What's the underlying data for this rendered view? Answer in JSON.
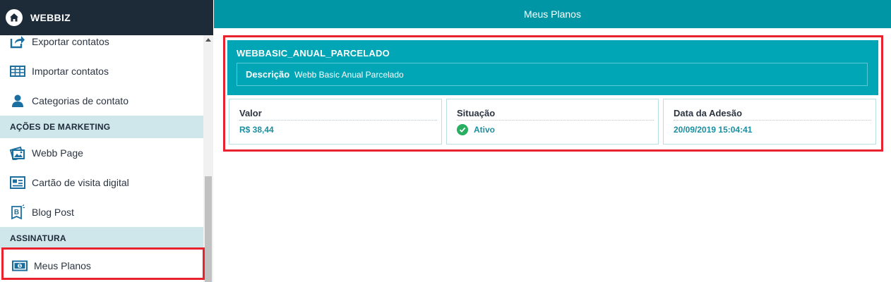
{
  "sidebar": {
    "brand": "WEBBIZ",
    "items_top": [
      {
        "label": "Exportar contatos",
        "icon": "export-icon"
      },
      {
        "label": "Importar contatos",
        "icon": "table-grid-icon"
      },
      {
        "label": "Categorias de contato",
        "icon": "user-icon"
      }
    ],
    "section_marketing": "AÇÕES DE MARKETING",
    "items_marketing": [
      {
        "label": "Webb Page",
        "icon": "webpage-icon"
      },
      {
        "label": "Cartão de visita digital",
        "icon": "contact-card-icon"
      },
      {
        "label": "Blog Post",
        "icon": "blog-post-icon"
      }
    ],
    "section_subscription": "ASSINATURA",
    "items_subscription": [
      {
        "label": "Meus Planos",
        "icon": "money-icon"
      }
    ]
  },
  "header": {
    "title": "Meus Planos"
  },
  "plan": {
    "name": "WEBBASIC_ANUAL_PARCELADO",
    "description_label": "Descrição",
    "description_value": "Webb Basic Anual Parcelado",
    "value_label": "Valor",
    "value": "R$ 38,44",
    "status_label": "Situação",
    "status": "Ativo",
    "date_label": "Data da Adesão",
    "date": "20/09/2019 15:04:41"
  },
  "colors": {
    "brand_bg": "#1d2a38",
    "header_bg": "#0096a6",
    "plan_bg": "#00a6b6",
    "section_bg": "#cfe6ea",
    "highlight": "#e8232e",
    "status_green": "#27ae60"
  }
}
